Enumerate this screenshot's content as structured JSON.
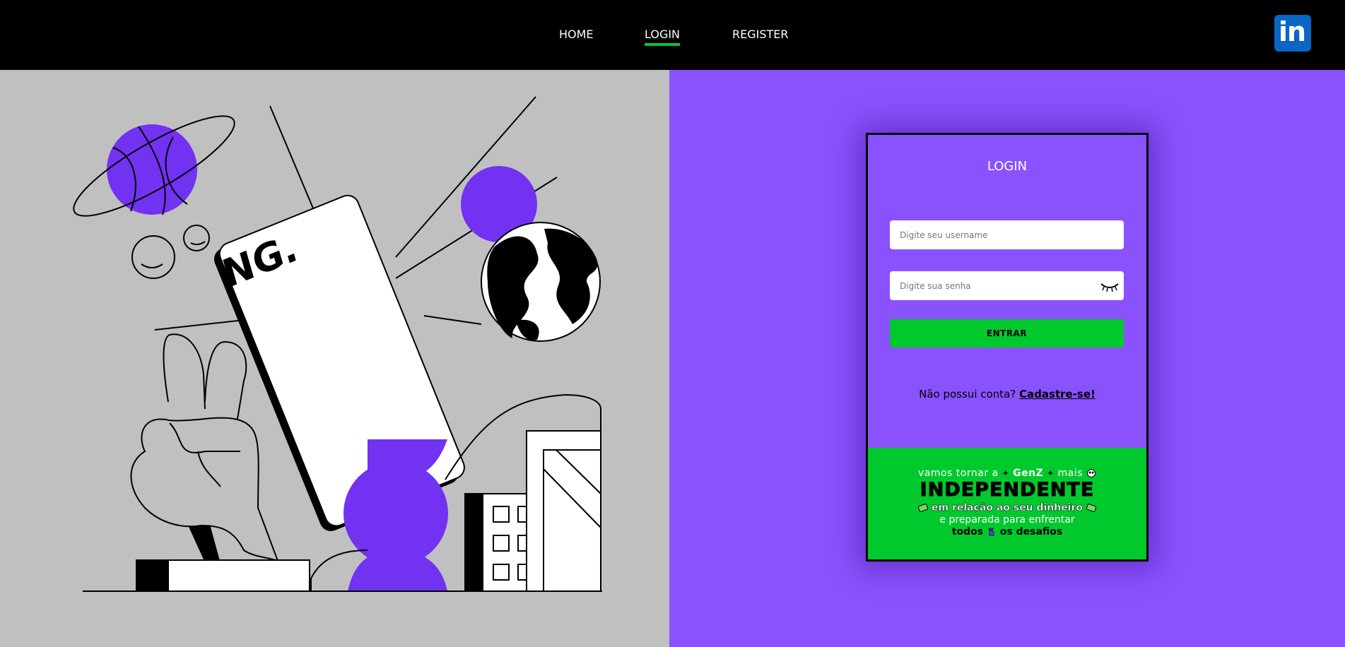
{
  "nav": {
    "links": [
      {
        "label": "HOME"
      },
      {
        "label": "LOGIN"
      },
      {
        "label": "REGISTER"
      }
    ],
    "active": "LOGIN",
    "linkedin_label": "in"
  },
  "illustration": {
    "phone_logo": "NG."
  },
  "login": {
    "title": "LOGIN",
    "username_placeholder": "Digite seu username",
    "password_placeholder": "Digite sua senha",
    "submit_label": "ENTRAR",
    "signup_prompt": "Não possui conta?",
    "signup_link": "Cadastre-se!"
  },
  "banner": {
    "line1_a": "vamos tornar a",
    "line1_b": "GenZ",
    "line1_c": "mais",
    "line2": "INDEPENDENTE",
    "line3": "em relação ao seu dinheiro",
    "line4": "e preparada para enfrentar",
    "line5_a": "todos",
    "line5_b": "os desafios"
  },
  "colors": {
    "nav_bg": "#000000",
    "accent_green": "#00c92e",
    "purple": "#8a52fd",
    "illustration_purple": "#7232f2",
    "gray_bg": "#c0c0c0",
    "linkedin_blue": "#0a66c2"
  }
}
